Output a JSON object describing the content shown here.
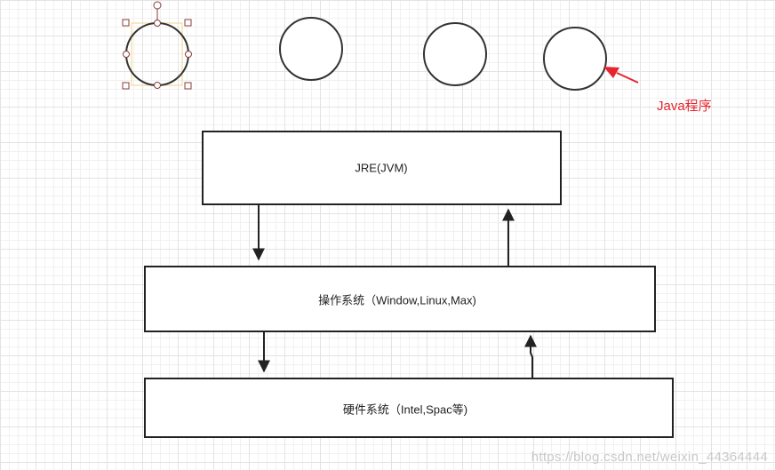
{
  "diagram": {
    "annotation_label": "Java程序",
    "boxes": {
      "jre": "JRE(JVM)",
      "os": "操作系统（Window,Linux,Max)",
      "hardware": "硬件系统（Intel,Spac等)"
    },
    "colors": {
      "stroke": "#222222",
      "annotation": "#e8242e",
      "selection_frame": "#f2d38a",
      "selection_handle": "#8a3b3b"
    }
  },
  "watermark": "https://blog.csdn.net/weixin_44364444"
}
